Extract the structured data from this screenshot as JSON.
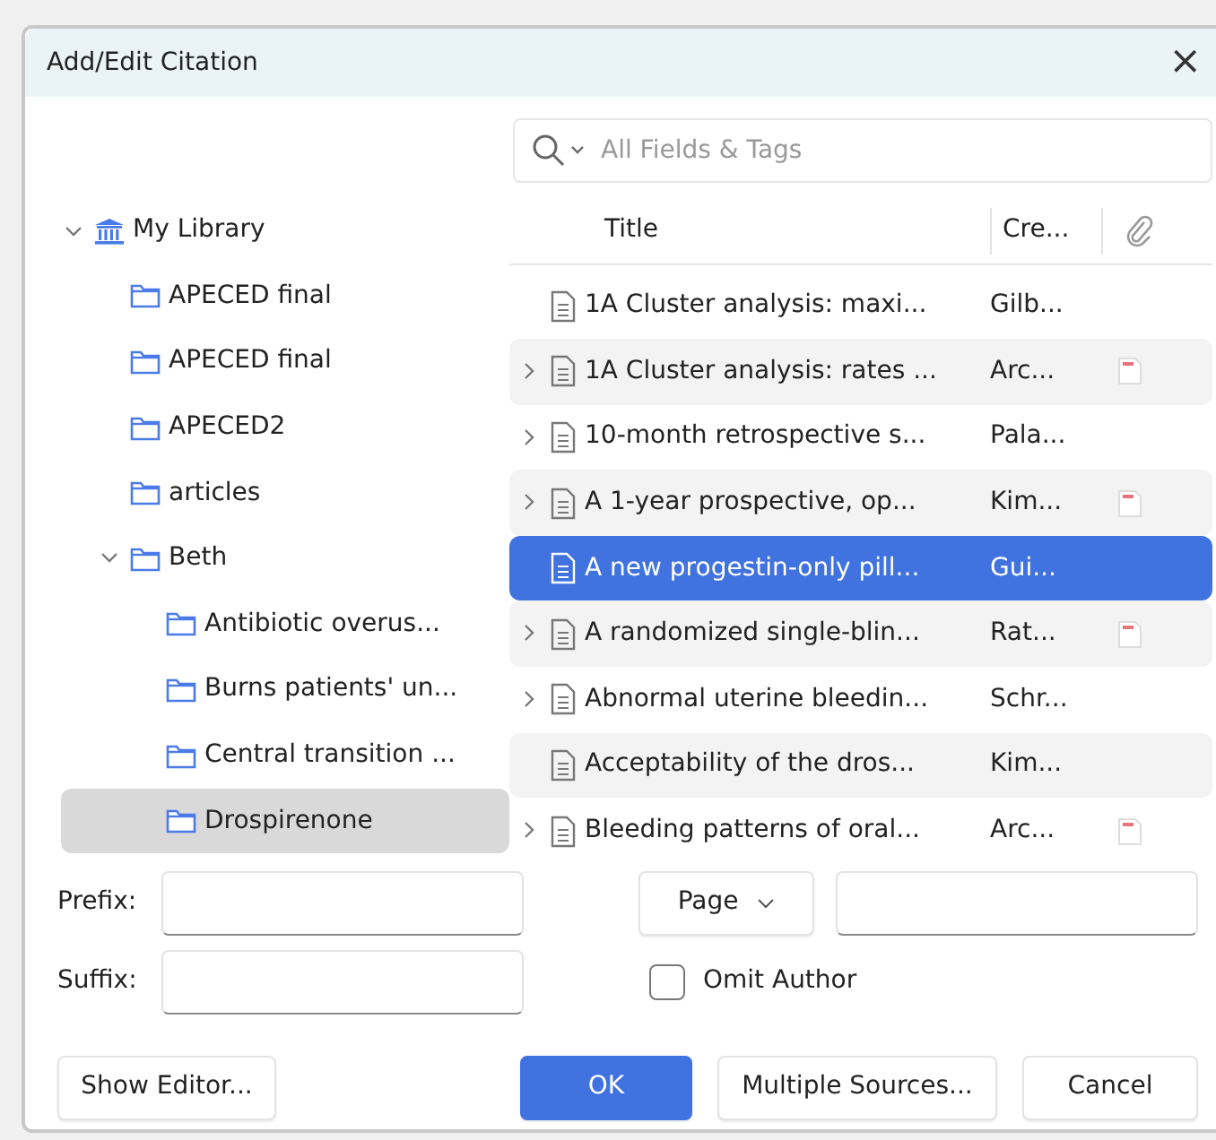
{
  "window": {
    "title": "Add/Edit Citation",
    "close": "×"
  },
  "search": {
    "placeholder": "All Fields & Tags"
  },
  "tree": [
    {
      "label": "My Library",
      "kind": "library",
      "expanded": true,
      "selected": false,
      "children": [
        {
          "label": "APECED final",
          "kind": "folder",
          "selected": false
        },
        {
          "label": "APECED final",
          "kind": "folder",
          "selected": false
        },
        {
          "label": "APECED2",
          "kind": "folder",
          "selected": false
        },
        {
          "label": "articles",
          "kind": "folder",
          "selected": false
        },
        {
          "label": "Beth",
          "kind": "folder",
          "expanded": true,
          "selected": false,
          "children": [
            {
              "label": "Antibiotic overus...",
              "kind": "folder",
              "selected": false
            },
            {
              "label": "Burns patients' un...",
              "kind": "folder",
              "selected": false
            },
            {
              "label": "Central transition ...",
              "kind": "folder",
              "selected": false
            },
            {
              "label": "Drospirenone",
              "kind": "folder",
              "selected": true
            }
          ]
        }
      ]
    }
  ],
  "table": {
    "columns": [
      "Title",
      "Cre..."
    ],
    "rows": [
      {
        "title": "1A Cluster analysis: maxi...",
        "creator": "Gilb...",
        "has_children": false,
        "attachment": false,
        "selected": false
      },
      {
        "title": "1A Cluster analysis: rates ...",
        "creator": "Arc...",
        "has_children": true,
        "attachment": true,
        "selected": false
      },
      {
        "title": "10-month retrospective s...",
        "creator": "Pala...",
        "has_children": true,
        "attachment": false,
        "selected": false
      },
      {
        "title": "A 1-year prospective, op...",
        "creator": "Kim...",
        "has_children": true,
        "attachment": true,
        "selected": false
      },
      {
        "title": "A new progestin-only pill...",
        "creator": "Gui...",
        "has_children": false,
        "attachment": false,
        "selected": true
      },
      {
        "title": "A randomized single-blin...",
        "creator": "Rat...",
        "has_children": true,
        "attachment": true,
        "selected": false
      },
      {
        "title": "Abnormal uterine bleedin...",
        "creator": "Schr...",
        "has_children": true,
        "attachment": false,
        "selected": false
      },
      {
        "title": "Acceptability of the dros...",
        "creator": "Kim...",
        "has_children": false,
        "attachment": false,
        "selected": false
      },
      {
        "title": "Bleeding patterns of oral...",
        "creator": "Arc...",
        "has_children": true,
        "attachment": true,
        "selected": false
      }
    ]
  },
  "prefix": {
    "label": "Prefix:"
  },
  "suffix": {
    "label": "Suffix:"
  },
  "locator": {
    "label": "Page"
  },
  "omit_author": {
    "label": "Omit Author",
    "checked": false
  },
  "buttons": [
    {
      "label": "Show Editor...",
      "kind": "secondary"
    },
    {
      "label": "OK",
      "kind": "primary"
    },
    {
      "label": "Multiple Sources...",
      "kind": "secondary"
    },
    {
      "label": "Cancel",
      "kind": "secondary"
    }
  ]
}
